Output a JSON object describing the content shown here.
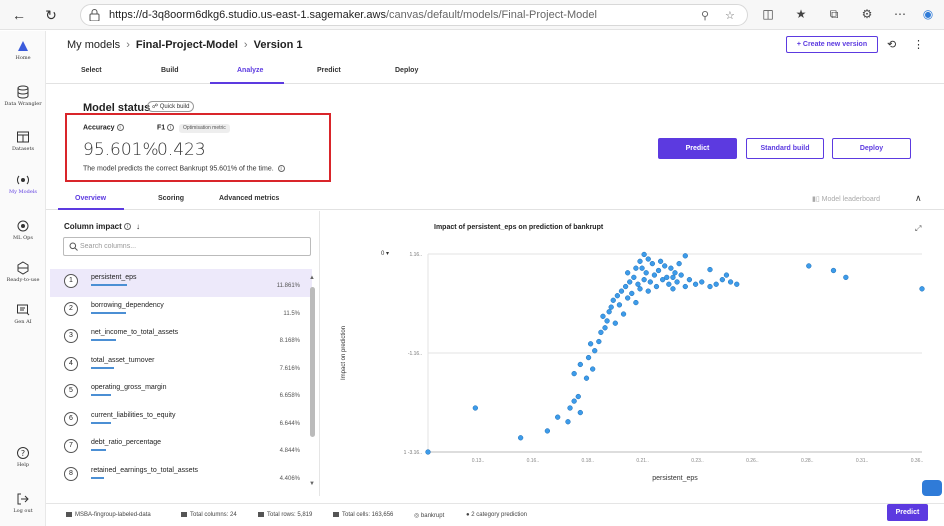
{
  "browser": {
    "url_host": "https://d-3q8oorm6dkg6.studio.us-east-1.sagemaker.aws",
    "url_path": "/canvas/default/models/Final-Project-Model"
  },
  "sidebar": {
    "items": [
      {
        "label": "Home",
        "icon": "home-icon"
      },
      {
        "label": "Data Wrangler",
        "icon": "database-icon"
      },
      {
        "label": "Datasets",
        "icon": "table-icon"
      },
      {
        "label": "My Models",
        "icon": "models-icon",
        "active": true
      },
      {
        "label": "ML Ops",
        "icon": "mlops-icon"
      },
      {
        "label": "Ready-to-use",
        "icon": "ready-icon"
      },
      {
        "label": "Gen AI",
        "icon": "genai-icon"
      },
      {
        "label": "Help",
        "icon": "help-icon"
      },
      {
        "label": "Log out",
        "icon": "logout-icon"
      }
    ]
  },
  "header": {
    "crumb_root": "My models",
    "crumb_model": "Final-Project-Model",
    "crumb_version": "Version 1",
    "create_btn": "+ Create new version"
  },
  "tabs": [
    "Select",
    "Build",
    "Analyze",
    "Predict",
    "Deploy"
  ],
  "status": {
    "title": "Model status",
    "quick_build": "Quick build",
    "accuracy_label": "Accuracy",
    "accuracy_value": "95.601%",
    "f1_label": "F1",
    "f1_badge": "Optimisation metric",
    "f1_value": "0.423",
    "note": "The model predicts the correct Bankrupt 95.601% of the time."
  },
  "actions": {
    "predict": "Predict",
    "standard_build": "Standard build",
    "deploy": "Deploy"
  },
  "subtabs": [
    "Overview",
    "Scoring",
    "Advanced metrics"
  ],
  "leaderboard": "Model leaderboard",
  "column_impact": {
    "title": "Column impact",
    "search_placeholder": "Search columns...",
    "rows": [
      {
        "n": "1",
        "name": "persistent_eps",
        "value": "11.861%",
        "impact": 11.861
      },
      {
        "n": "2",
        "name": "borrowing_dependency",
        "value": "11.5%",
        "impact": 11.5
      },
      {
        "n": "3",
        "name": "net_income_to_total_assets",
        "value": "8.168%",
        "impact": 8.168
      },
      {
        "n": "4",
        "name": "total_asset_turnover",
        "value": "7.616%",
        "impact": 7.616
      },
      {
        "n": "5",
        "name": "operating_gross_margin",
        "value": "6.658%",
        "impact": 6.658
      },
      {
        "n": "6",
        "name": "current_liabilities_to_equity",
        "value": "6.644%",
        "impact": 6.644
      },
      {
        "n": "7",
        "name": "debt_ratio_percentage",
        "value": "4.844%",
        "impact": 4.844
      },
      {
        "n": "8",
        "name": "retained_earnings_to_total_assets",
        "value": "4.406%",
        "impact": 4.406
      }
    ]
  },
  "chart": {
    "value_dropdown": "0"
  },
  "chart_data": {
    "type": "scatter",
    "title": "Impact of persistent_eps on prediction of bankrupt",
    "xlabel": "persistent_eps",
    "ylabel": "Impact on prediction",
    "x_ticks": [
      "0.13..",
      "0.16..",
      "0.18..",
      "0.21..",
      "0.23..",
      "0.26..",
      "0.28..",
      "0.31..",
      "0.36.."
    ],
    "y_ticks": [
      "1.16..",
      "-1.16..",
      "-3.16.."
    ],
    "xlim": [
      0.125,
      0.365
    ],
    "ylim": [
      -3.16,
      1.16
    ],
    "color": "#3d9be9",
    "points": [
      [
        0.125,
        -3.16
      ],
      [
        0.148,
        -2.2
      ],
      [
        0.17,
        -2.85
      ],
      [
        0.183,
        -2.7
      ],
      [
        0.188,
        -2.4
      ],
      [
        0.193,
        -2.5
      ],
      [
        0.194,
        -2.2
      ],
      [
        0.196,
        -2.05
      ],
      [
        0.198,
        -1.95
      ],
      [
        0.199,
        -2.3
      ],
      [
        0.196,
        -1.45
      ],
      [
        0.199,
        -1.25
      ],
      [
        0.202,
        -1.55
      ],
      [
        0.203,
        -1.1
      ],
      [
        0.206,
        -0.95
      ],
      [
        0.204,
        -0.8
      ],
      [
        0.205,
        -1.35
      ],
      [
        0.208,
        -0.75
      ],
      [
        0.209,
        -0.55
      ],
      [
        0.211,
        -0.45
      ],
      [
        0.212,
        -0.3
      ],
      [
        0.21,
        -0.2
      ],
      [
        0.213,
        -0.1
      ],
      [
        0.214,
        0.0
      ],
      [
        0.216,
        -0.35
      ],
      [
        0.215,
        0.15
      ],
      [
        0.217,
        0.25
      ],
      [
        0.218,
        0.05
      ],
      [
        0.219,
        0.35
      ],
      [
        0.22,
        -0.15
      ],
      [
        0.221,
        0.45
      ],
      [
        0.222,
        0.2
      ],
      [
        0.223,
        0.55
      ],
      [
        0.224,
        0.3
      ],
      [
        0.225,
        0.65
      ],
      [
        0.226,
        0.1
      ],
      [
        0.227,
        0.5
      ],
      [
        0.228,
        0.4
      ],
      [
        0.229,
        0.85
      ],
      [
        0.23,
        0.6
      ],
      [
        0.231,
        0.75
      ],
      [
        0.232,
        0.35
      ],
      [
        0.233,
        0.55
      ],
      [
        0.234,
        0.95
      ],
      [
        0.235,
        0.7
      ],
      [
        0.236,
        0.45
      ],
      [
        0.237,
        0.8
      ],
      [
        0.238,
        1.0
      ],
      [
        0.239,
        0.6
      ],
      [
        0.24,
        0.9
      ],
      [
        0.241,
        0.65
      ],
      [
        0.242,
        0.5
      ],
      [
        0.243,
        0.85
      ],
      [
        0.244,
        0.4
      ],
      [
        0.245,
        0.75
      ],
      [
        0.246,
        0.55
      ],
      [
        0.247,
        0.95
      ],
      [
        0.248,
        0.7
      ],
      [
        0.25,
        0.45
      ],
      [
        0.252,
        0.6
      ],
      [
        0.255,
        0.5
      ],
      [
        0.258,
        0.55
      ],
      [
        0.262,
        0.45
      ],
      [
        0.265,
        0.5
      ],
      [
        0.268,
        0.6
      ],
      [
        0.272,
        0.55
      ],
      [
        0.275,
        0.5
      ],
      [
        0.232,
        1.05
      ],
      [
        0.228,
        1.0
      ],
      [
        0.25,
        1.12
      ],
      [
        0.262,
        0.82
      ],
      [
        0.27,
        0.7
      ],
      [
        0.31,
        0.9
      ],
      [
        0.322,
        0.8
      ],
      [
        0.328,
        0.65
      ],
      [
        0.365,
        0.4
      ],
      [
        0.23,
        1.15
      ],
      [
        0.244,
        0.65
      ],
      [
        0.222,
        0.75
      ],
      [
        0.226,
        0.85
      ]
    ]
  },
  "statusbar": {
    "dataset": "MSBA-fingroup-labeled-data",
    "total_columns": "Total columns: 24",
    "total_rows": "Total rows: 5,819",
    "total_cells": "Total cells: 163,656",
    "target": "bankrupt",
    "prediction": "2 category prediction",
    "predict_btn": "Predict"
  }
}
